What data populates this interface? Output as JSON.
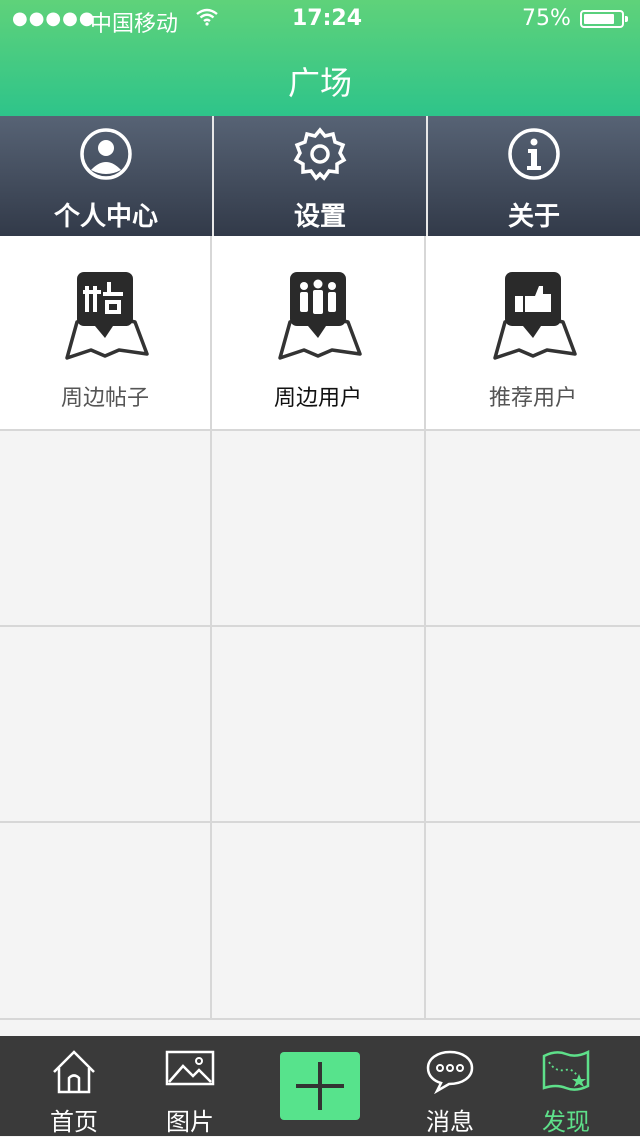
{
  "status": {
    "signal": "●●●●●",
    "carrier": "中国移动",
    "time": "17:24",
    "battery": "75%",
    "battery_level": 0.75
  },
  "header": {
    "title": "广场"
  },
  "menu": [
    {
      "label": "个人中心",
      "icon": "user-circle-icon"
    },
    {
      "label": "设置",
      "icon": "gear-icon"
    },
    {
      "label": "关于",
      "icon": "info-icon"
    }
  ],
  "grid": [
    {
      "label": "周边帖子",
      "icon": "posts-map-icon"
    },
    {
      "label": "周边用户",
      "icon": "users-map-icon"
    },
    {
      "label": "推荐用户",
      "icon": "thumbs-up-map-icon"
    }
  ],
  "tabs": [
    {
      "label": "首页",
      "icon": "home-icon"
    },
    {
      "label": "图片",
      "icon": "image-icon"
    },
    {
      "label": "",
      "icon": "plus-icon"
    },
    {
      "label": "消息",
      "icon": "chat-bubble-icon"
    },
    {
      "label": "发现",
      "icon": "map-star-icon"
    }
  ],
  "colors": {
    "header_green": "#2ec48a",
    "menu_dark": "#3a4252",
    "tabbar": "#3a3a3a",
    "accent": "#57e38c"
  }
}
